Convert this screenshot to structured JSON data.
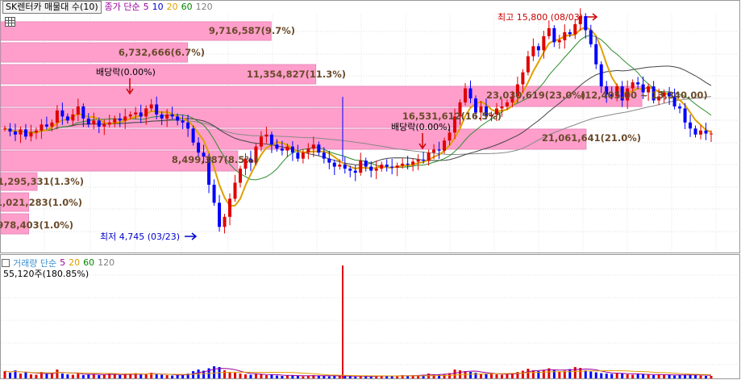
{
  "header": {
    "title": "SK렌터카 매물대 수(10)",
    "indicator_label": "종가 단순",
    "ma_periods": [
      "5",
      "10",
      "20",
      "60",
      "120"
    ]
  },
  "volume_header": {
    "label": "거래량 단순",
    "ma_periods": [
      "5",
      "20",
      "60",
      "120"
    ],
    "value": "55,120주(180.85%)"
  },
  "colors": {
    "price_up": "#e00000",
    "price_down": "#0000ff",
    "profile_bar": "#ff9ecb",
    "ma5": "#e0a000",
    "ma20": "#2e8b2e",
    "ma60": "#444444",
    "ma120": "#888888"
  },
  "chart_data": {
    "type": "candlestick-volume-profile",
    "price_range": [
      4745,
      15800
    ],
    "volume_profile": [
      {
        "label": "9,716,587(9.7%)",
        "pct": 9.7
      },
      {
        "label": "6,732,666(6.7%)",
        "pct": 6.7
      },
      {
        "label": "11,354,827(11.3%)",
        "pct": 11.3
      },
      {
        "label": "23,030,619(23.0%)",
        "pct": 23.0
      },
      {
        "label": "16,531,612(16.5%)",
        "pct": 16.5
      },
      {
        "label": "21,061,641(21.0%)",
        "pct": 21.0
      },
      {
        "label": "8,499,387(8.5%)",
        "pct": 8.5
      },
      {
        "label": "1,295,331(1.3%)",
        "pct": 1.3
      },
      {
        "label": "1,021,283(1.0%)",
        "pct": 1.0
      },
      {
        "label": "978,403(1.0%)",
        "pct": 1.0
      }
    ],
    "annotations": {
      "high": "최고 15,800 (08/03)",
      "low": "최저 4,745 (03/23)",
      "dividend_1": "배당락(0.00%)",
      "dividend_2": "배당락(0.00%)",
      "range_note": "(12,405.00 ~ 13,340.00)"
    },
    "prices": [
      10200,
      10050,
      9900,
      10150,
      9800,
      10000,
      10100,
      10400,
      10300,
      10500,
      11100,
      10800,
      10600,
      10900,
      11300,
      10700,
      10400,
      10600,
      10300,
      10400,
      10500,
      10700,
      10600,
      10800,
      10900,
      11000,
      10800,
      11200,
      11400,
      10900,
      10700,
      10900,
      10800,
      10600,
      10500,
      10200,
      9500,
      9000,
      8800,
      7400,
      6500,
      5300,
      5800,
      6700,
      7500,
      8200,
      8700,
      8500,
      9300,
      9800,
      9900,
      9400,
      9200,
      9100,
      9300,
      9000,
      8700,
      9000,
      9200,
      9400,
      9000,
      8700,
      8500,
      8300,
      8400,
      8200,
      8100,
      8000,
      8600,
      8300,
      8100,
      8200,
      8400,
      8300,
      8250,
      8350,
      8450,
      8400,
      8550,
      8650,
      8600,
      9000,
      9150,
      9100,
      9600,
      10000,
      10800,
      11500,
      12200,
      11700,
      11000,
      11300,
      10800,
      10900,
      11200,
      11300,
      11500,
      11800,
      12400,
      13000,
      13800,
      14300,
      14100,
      14800,
      15200,
      14500,
      14600,
      15000,
      14900,
      15400,
      15800,
      15100,
      14400,
      13400,
      12300,
      11900,
      11800,
      12300,
      11600,
      12200,
      12500,
      12400,
      12000,
      12300,
      11600,
      11800,
      12000,
      11800,
      11300,
      11200,
      10500,
      10200,
      9900,
      10100,
      9950,
      9950
    ],
    "volume": [
      18,
      14,
      20,
      12,
      15,
      10,
      9,
      16,
      11,
      13,
      22,
      12,
      10,
      9,
      14,
      8,
      9,
      11,
      8,
      10,
      12,
      9,
      8,
      10,
      11,
      13,
      9,
      12,
      14,
      10,
      9,
      8,
      7,
      9,
      10,
      12,
      18,
      22,
      19,
      25,
      30,
      28,
      20,
      16,
      14,
      12,
      10,
      9,
      12,
      10,
      8,
      9,
      7,
      6,
      8,
      7,
      6,
      5,
      7,
      8,
      7,
      6,
      5,
      6,
      7,
      6,
      5,
      4,
      6,
      5,
      5,
      6,
      7,
      6,
      5,
      6,
      8,
      7,
      8,
      7,
      9,
      12,
      10,
      9,
      11,
      13,
      22,
      20,
      18,
      16,
      14,
      12,
      11,
      12,
      10,
      9,
      11,
      13,
      16,
      19,
      24,
      20,
      18,
      21,
      25,
      22,
      17,
      19,
      23,
      28,
      26,
      20,
      17,
      15,
      13,
      12,
      11,
      14,
      12,
      10,
      9,
      11,
      10,
      9,
      8,
      9,
      10,
      9,
      7,
      8,
      9,
      10,
      8,
      7,
      6,
      6
    ],
    "volume_peak_index": 66,
    "volume_peak": 140,
    "volume_peak_label": "55,120주(180.85%)"
  }
}
